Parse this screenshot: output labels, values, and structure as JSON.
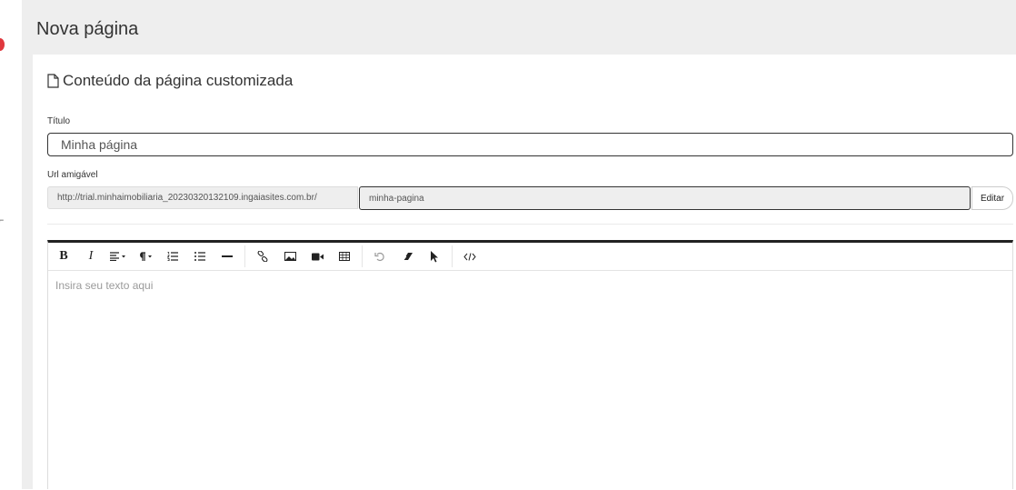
{
  "page": {
    "title": "Nova página"
  },
  "section": {
    "title": "Conteúdo da página customizada"
  },
  "form": {
    "title_label": "Título",
    "title_value": "Minha página",
    "url_label": "Url amigável",
    "url_prefix": "http://trial.minhaimobiliaria_20230320132109.ingaiasites.com.br/",
    "url_value": "minha-pagina",
    "edit_label": "Editar"
  },
  "editor": {
    "placeholder": "Insira seu texto aqui",
    "bold_label": "B",
    "italic_label": "I",
    "toolbar_icons": [
      "bold-icon",
      "italic-icon",
      "align-icon",
      "paragraph-icon",
      "ordered-list-icon",
      "unordered-list-icon",
      "horizontal-rule-icon",
      "link-icon",
      "image-icon",
      "video-icon",
      "table-icon",
      "undo-icon",
      "eraser-icon",
      "pointer-icon",
      "code-view-icon"
    ]
  },
  "colors": {
    "rail_accent": "#e0383e",
    "editor_border": "#222222"
  }
}
